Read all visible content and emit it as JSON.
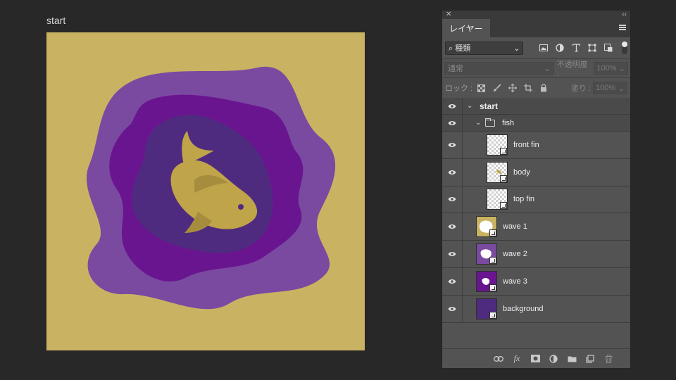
{
  "document": {
    "title": "start"
  },
  "artwork": {
    "colors": {
      "background": "#c9b363",
      "wave1": "#7a4aa0",
      "wave2": "#6a1590",
      "wave3": "#4f2b7f",
      "fish": "#bfa44a",
      "fish_fin": "#a68d3e",
      "eye": "#4f2b7f"
    }
  },
  "panel": {
    "close_glyph": "✕",
    "collapse_glyph": "‹‹",
    "tab_label": "レイヤー",
    "filter": {
      "value": "⌕ 種類",
      "arrow": "⌄"
    },
    "filter_icons": [
      "image-filter-icon",
      "adjustment-filter-icon",
      "type-filter-icon",
      "shape-filter-icon",
      "smart-object-filter-icon"
    ],
    "blend": {
      "mode": "通常",
      "opacity_label": "不透明度 :",
      "opacity_value": "100%"
    },
    "lock": {
      "label": "ロック :",
      "fill_label": "塗り :",
      "fill_value": "100%"
    },
    "layers": [
      {
        "name": "start",
        "type": "group",
        "indent": 0
      },
      {
        "name": "fish",
        "type": "group",
        "indent": 1
      },
      {
        "name": "front fin",
        "type": "smart",
        "indent": 2,
        "thumb": "checker"
      },
      {
        "name": "body",
        "type": "smart",
        "indent": 2,
        "thumb": "checker"
      },
      {
        "name": "top fin",
        "type": "smart",
        "indent": 2,
        "thumb": "checker"
      },
      {
        "name": "wave 1",
        "type": "smart",
        "indent": 1,
        "thumb": "#c9b363"
      },
      {
        "name": "wave 2",
        "type": "smart",
        "indent": 1,
        "thumb": "#7a4aa0"
      },
      {
        "name": "wave 3",
        "type": "smart",
        "indent": 1,
        "thumb": "#6a1590"
      },
      {
        "name": "background",
        "type": "smart",
        "indent": 1,
        "thumb": "#4f2b7f"
      }
    ],
    "footer_icons": [
      "link-layers-icon",
      "fx-icon",
      "add-mask-icon",
      "new-adjustment-icon",
      "new-group-icon",
      "new-layer-icon",
      "delete-layer-icon"
    ],
    "fx_label": "fx"
  }
}
